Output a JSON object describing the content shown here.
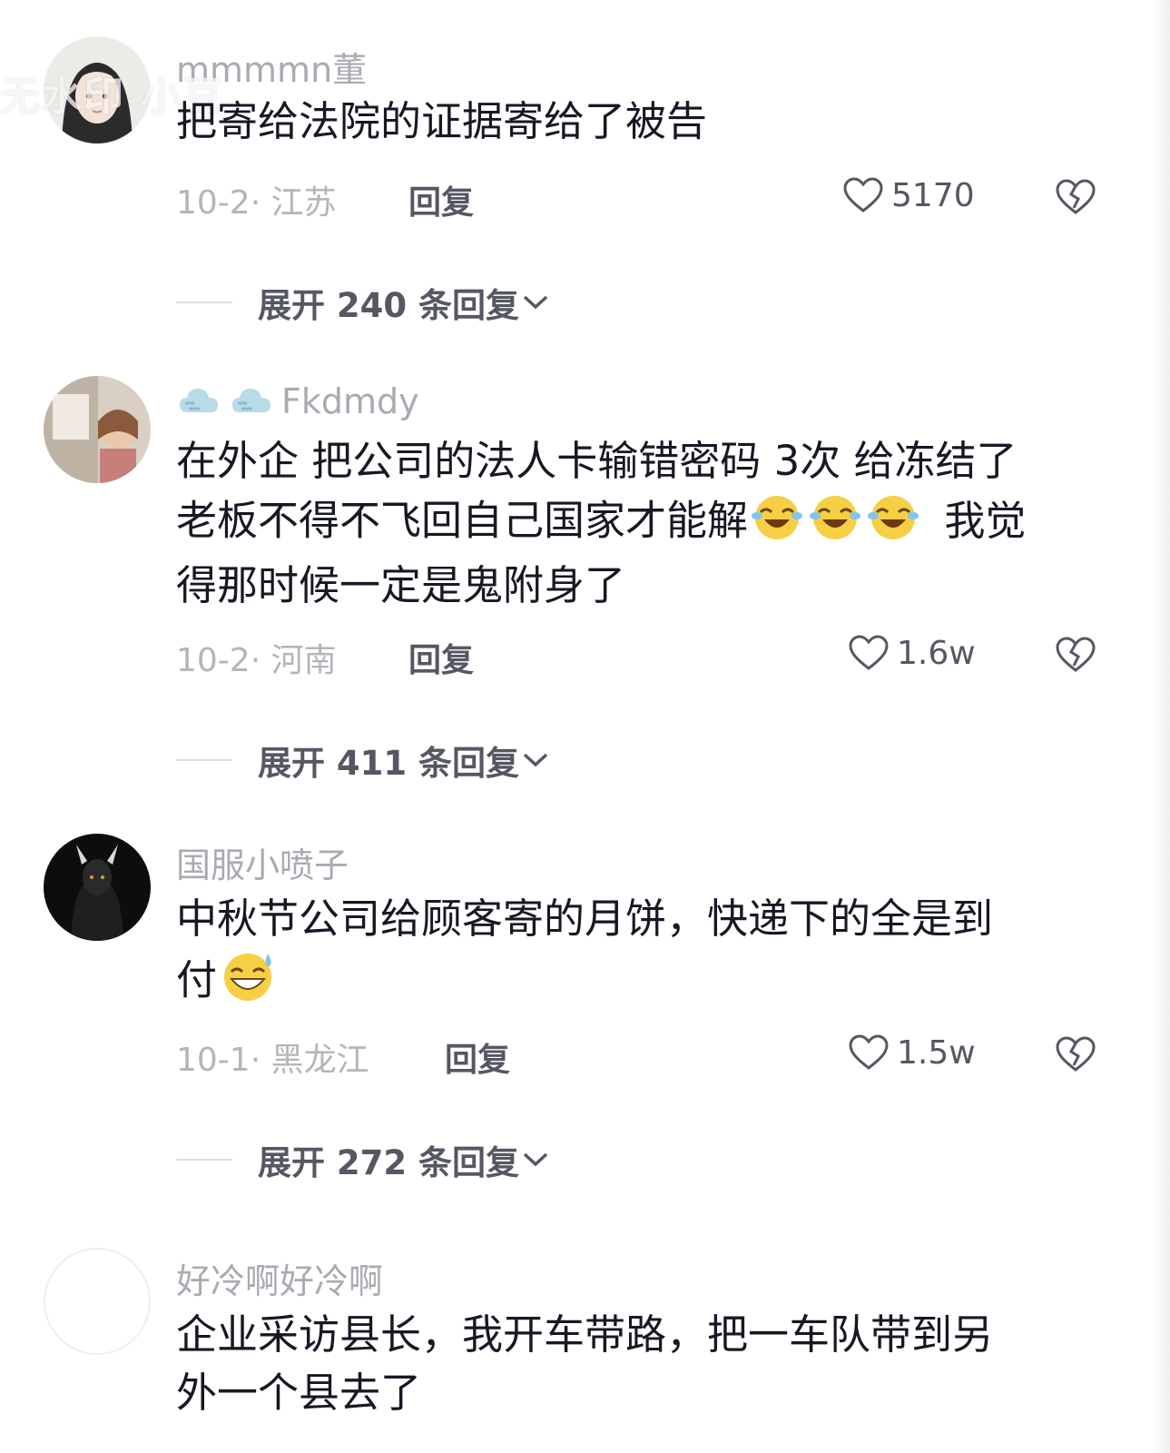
{
  "comments": [
    {
      "username": "mmmmn董",
      "text": "把寄给法院的证据寄给了被告",
      "date_location": "10-2· 江苏",
      "reply_label": "回复",
      "likes": "5170",
      "expand_label": "展开 240 条回复"
    },
    {
      "username": "Fkdmdy",
      "text_line1": "在外企 把公司的法人卡输错密码 3次 给冻结了",
      "text_line2a": "老板不得不飞回自己国家才能解",
      "text_line2b": "我觉",
      "text_line3": "得那时候一定是鬼附身了",
      "date_location": "10-2· 河南",
      "reply_label": "回复",
      "likes": "1.6w",
      "expand_label": "展开 411 条回复"
    },
    {
      "username": "国服小喷子",
      "text_line1": "中秋节公司给顾客寄的月饼，快递下的全是到",
      "text_line2": "付",
      "date_location": "10-1· 黑龙江",
      "reply_label": "回复",
      "likes": "1.5w",
      "expand_label": "展开 272 条回复"
    },
    {
      "username": "好冷啊好冷啊",
      "text_line1": "企业采访县长，我开车带路，把一车队带到另",
      "text_line2": "外一个县去了"
    }
  ],
  "watermark": "无水印 小豆",
  "colors": {
    "text": "#161823",
    "username": "#a9abb2",
    "meta": "#b3b5bb",
    "action": "#555862"
  }
}
